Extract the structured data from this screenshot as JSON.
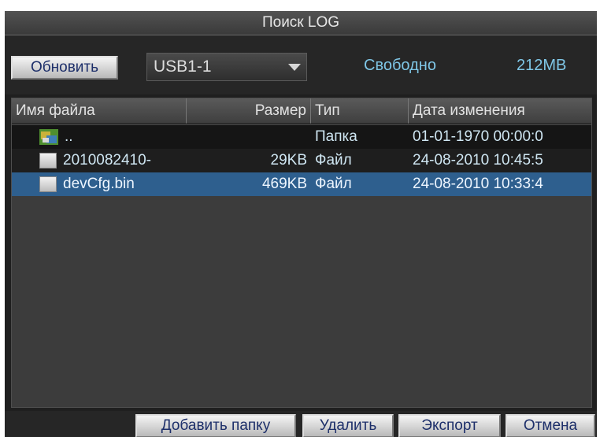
{
  "window": {
    "title": "Поиск LOG"
  },
  "toolbar": {
    "refresh_label": "Обновить",
    "device": {
      "selected": "USB1-1"
    },
    "free_label": "Свободно",
    "free_value": "212MB"
  },
  "table": {
    "columns": [
      "Имя файла",
      "Размер",
      "Тип",
      "Дата изменения"
    ],
    "rows": [
      {
        "icon": "folder-icon",
        "name": "..",
        "size": "",
        "type": "Папка",
        "date": "01-01-1970 00:00:0"
      },
      {
        "icon": "file-icon",
        "name": "2010082410-",
        "size": "29KB",
        "type": "Файл",
        "date": "24-08-2010 10:45:5"
      },
      {
        "icon": "file-icon",
        "name": "devCfg.bin",
        "size": "469KB",
        "type": "Файл",
        "date": "24-08-2010 10:33:4"
      }
    ],
    "selected_row": 2
  },
  "buttons": {
    "add_folder": "Добавить папку",
    "delete": "Удалить",
    "export": "Экспорт",
    "cancel": "Отмена"
  },
  "colors": {
    "selection": "#2e5f8e",
    "info_text": "#7fc6e6",
    "button_text": "#1d2f6a"
  }
}
